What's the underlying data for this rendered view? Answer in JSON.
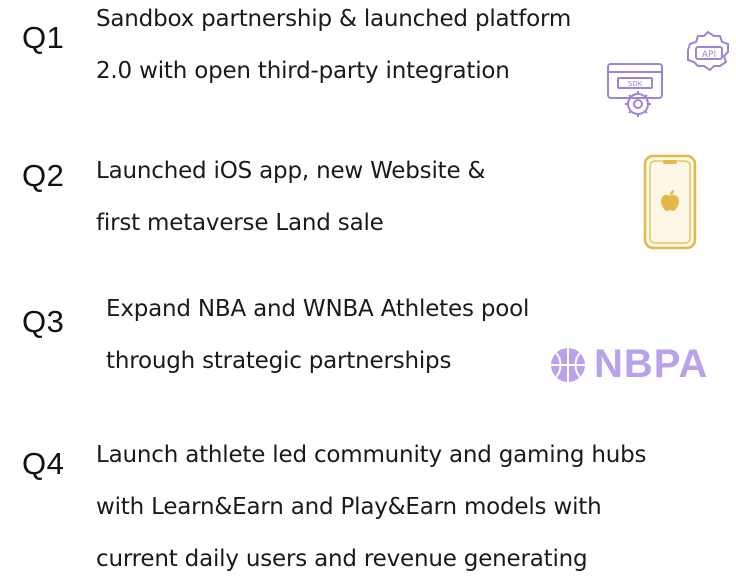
{
  "roadmap": {
    "q1": {
      "label": "Q1",
      "lines": [
        "Sandbox partnership & launched platform",
        "2.0 with open third-party integration"
      ],
      "icon": "api-sdk-icon",
      "icon_text_api": "API",
      "icon_text_sdk": "SDK"
    },
    "q2": {
      "label": "Q2",
      "lines": [
        "Launched iOS app, new Website &",
        "first metaverse Land sale"
      ],
      "icon": "iphone-apple-icon"
    },
    "q3": {
      "label": "Q3",
      "lines": [
        "Expand NBA and WNBA Athletes pool",
        "through strategic partnerships"
      ],
      "logo_text": "NBPA"
    },
    "q4": {
      "label": "Q4",
      "lines": [
        "Launch athlete led community and gaming hubs",
        "with Learn&Earn and Play&Earn models with",
        "current daily users and revenue generating"
      ]
    }
  },
  "colors": {
    "icon_purple": "#9b86d6",
    "phone_gold": "#e2b84a",
    "nbpa_lavender": "#b9a2ea"
  }
}
